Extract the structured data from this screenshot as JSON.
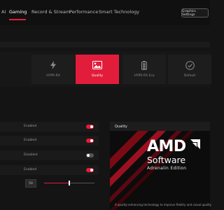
{
  "nav": {
    "tabs": [
      {
        "label": "AI"
      },
      {
        "label": "Gaming"
      },
      {
        "label": "Record & Stream"
      },
      {
        "label": "Performance"
      },
      {
        "label": "Smart Technology"
      }
    ],
    "active_tab": "Gaming",
    "graphics_button": "Graphics Settings"
  },
  "profiles": {
    "cards": [
      {
        "label": "HYPR-RX",
        "icon": "lightning-icon",
        "active": false
      },
      {
        "label": "Quality",
        "icon": "image-icon",
        "active": true
      },
      {
        "label": "HYPR-RX Eco",
        "icon": "battery-icon",
        "active": false
      },
      {
        "label": "Default",
        "icon": "checkmark-circle-icon",
        "active": false
      }
    ]
  },
  "settings": {
    "rows": [
      {
        "label": "Enabled",
        "state": "on"
      },
      {
        "label": "Enabled",
        "state": "on"
      },
      {
        "label": "Disabled",
        "state": "off"
      },
      {
        "label": "Enabled",
        "state": "on"
      }
    ],
    "slider": {
      "value": "50",
      "fraction": 0.5
    }
  },
  "info": {
    "title": "Quality",
    "brand": "AMD",
    "product": "Software",
    "edition": "Adrenalin Edition",
    "description": "A quality-enhancing technology to improve fidelity and visual quality"
  },
  "colors": {
    "accent": "#e21d3b",
    "background": "#141414"
  }
}
